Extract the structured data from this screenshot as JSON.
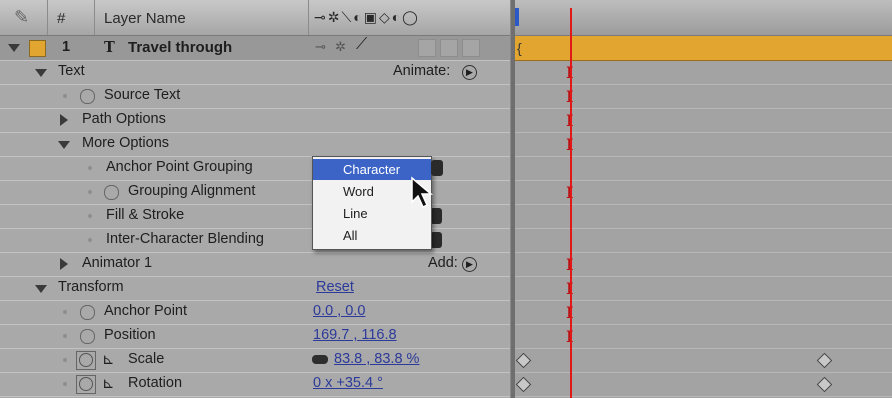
{
  "header": {
    "number_col": "#",
    "name_col": "Layer Name",
    "switch_glyphs": "⊸✲⟍◐▣◇◐◯"
  },
  "layer": {
    "number": "1",
    "type_glyph": "T",
    "name": "Travel through"
  },
  "rows": {
    "text": "Text",
    "animate_label": "Animate:",
    "source_text": "Source Text",
    "path_options": "Path Options",
    "more_options": "More Options",
    "anchor_point_grouping": "Anchor Point Grouping",
    "grouping_alignment": "Grouping Alignment",
    "fill_stroke": "Fill & Stroke",
    "inter_char_blending": "Inter-Character Blending",
    "animator1": "Animator 1",
    "add_label": "Add:",
    "transform": "Transform",
    "reset": "Reset",
    "anchor_point": "Anchor Point",
    "anchor_point_value": "0.0 , 0.0",
    "position": "Position",
    "position_value": "169.7 , 116.8",
    "scale": "Scale",
    "scale_value": "83.8 , 83.8 %",
    "rotation": "Rotation",
    "rotation_value": "0 x +35.4 °"
  },
  "dropdown": {
    "options": [
      "Character",
      "Word",
      "Line",
      "All"
    ],
    "selected": "Character"
  },
  "colors": {
    "layer_bar": "#e1a530",
    "current_time_indicator": "#e01818",
    "selection": "#3c63c6",
    "value_link": "#2c3a9a"
  }
}
